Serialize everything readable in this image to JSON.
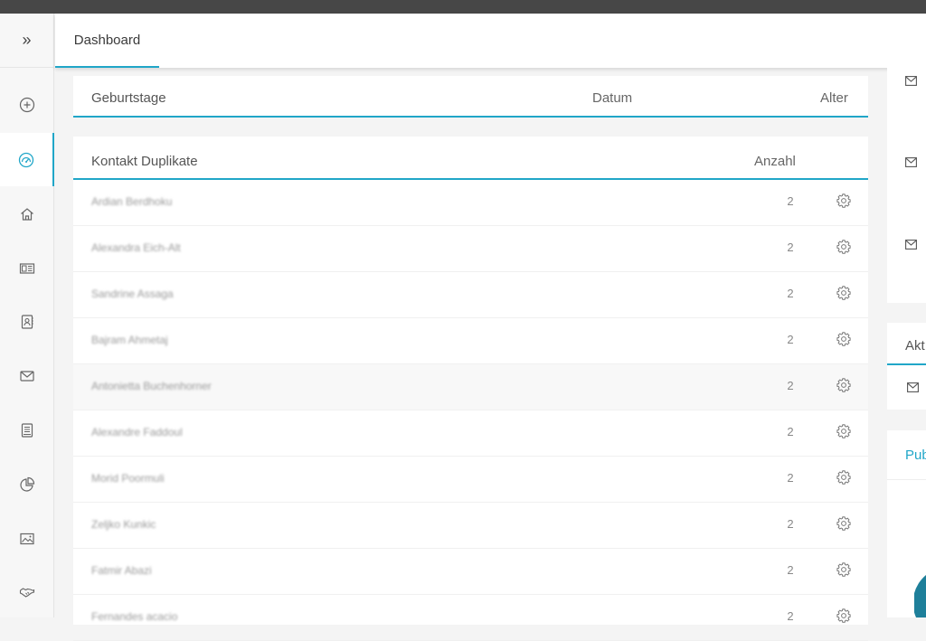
{
  "sidebar": {
    "toggle_label": "»",
    "items": [
      {
        "icon": "plus-circle-icon"
      },
      {
        "icon": "dashboard-gauge-icon",
        "active": true
      },
      {
        "icon": "home-icon"
      },
      {
        "icon": "newspaper-icon"
      },
      {
        "icon": "contact-card-icon"
      },
      {
        "icon": "mail-icon"
      },
      {
        "icon": "notebook-icon"
      },
      {
        "icon": "pie-chart-icon"
      },
      {
        "icon": "image-icon"
      },
      {
        "icon": "handshake-icon"
      }
    ]
  },
  "header": {
    "tab_label": "Dashboard"
  },
  "birthdays": {
    "title": "Geburtstage",
    "col_date": "Datum",
    "col_age": "Alter"
  },
  "duplicates": {
    "title": "Kontakt Duplikate",
    "col_count": "Anzahl",
    "rows": [
      {
        "name": "Ardian Berdhoku",
        "count": "2"
      },
      {
        "name": "Alexandra Eich-Alt",
        "count": "2"
      },
      {
        "name": "Sandrine Assaga",
        "count": "2"
      },
      {
        "name": "Bajram Ahmetaj",
        "count": "2"
      },
      {
        "name": "Antonietta Buchenhorner",
        "count": "2"
      },
      {
        "name": "Alexandre Faddoul",
        "count": "2"
      },
      {
        "name": "Morid Poormuli",
        "count": "2"
      },
      {
        "name": "Zeljko Kunkic",
        "count": "2"
      },
      {
        "name": "Fatmir Abazi",
        "count": "2"
      },
      {
        "name": "Fernandes acacio",
        "count": "2"
      }
    ]
  },
  "right": {
    "activities_title": "Akt",
    "pub_title": "Pub"
  },
  "colors": {
    "accent": "#20a6c8",
    "topbar": "#474747"
  }
}
